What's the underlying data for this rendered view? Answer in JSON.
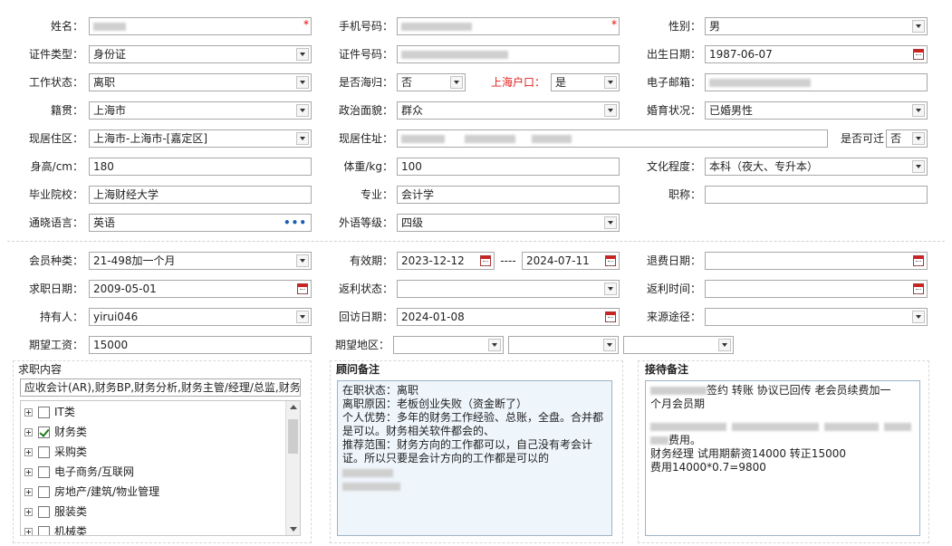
{
  "labels": {
    "name": "姓名：",
    "phone": "手机号码：",
    "gender": "性别：",
    "id_type": "证件类型：",
    "id_no": "证件号码：",
    "birth": "出生日期：",
    "work_status": "工作状态：",
    "returnee": "是否海归：",
    "sh_hukou": "上海户口：",
    "email": "电子邮箱：",
    "native": "籍贯：",
    "political": "政治面貌：",
    "marital": "婚育状况：",
    "residence_area": "现居住区：",
    "address": "现居住址：",
    "relocate": "是否可迁",
    "height": "身高/cm：",
    "weight": "体重/kg：",
    "education": "文化程度：",
    "school": "毕业院校：",
    "major": "专业：",
    "title": "职称：",
    "language": "通晓语言：",
    "lang_level": "外语等级：",
    "member_type": "会员种类：",
    "validity": "有效期：",
    "refund_date": "退费日期：",
    "job_date": "求职日期：",
    "rebate_status": "返利状态：",
    "rebate_time": "返利时间：",
    "holder": "持有人：",
    "visit_date": "回访日期：",
    "source": "来源途径：",
    "salary": "期望工资：",
    "region": "期望地区：",
    "range_sep": "----"
  },
  "values": {
    "gender": "男",
    "id_type": "身份证",
    "birth": "1987-06-07",
    "work_status": "离职",
    "returnee": "否",
    "sh_hukou": "是",
    "native": "上海市",
    "political": "群众",
    "marital": "已婚男性",
    "residence_area": "上海市-上海市-[嘉定区]",
    "relocate": "否",
    "height": "180",
    "weight": "100",
    "education": "本科（夜大、专升本）",
    "school": "上海财经大学",
    "major": "会计学",
    "title": "",
    "language": "英语",
    "lang_level": "四级",
    "member_type": "21-498加一个月",
    "validity_start": "2023-12-12",
    "validity_end": "2024-07-11",
    "refund_date": "",
    "job_date": "2009-05-01",
    "rebate_status": "",
    "rebate_time": "",
    "holder": "yirui046",
    "visit_date": "2024-01-08",
    "source": "",
    "salary": "15000",
    "region_1": "",
    "region_2": "",
    "region_3": ""
  },
  "required_mark": "*",
  "lang_more": "•••",
  "job_content": {
    "title": "求职内容",
    "summary": "应收会计(AR),财务BP,财务分析,财务主管/经理/总监,财务",
    "items": [
      {
        "label": "IT类",
        "checked": false
      },
      {
        "label": "财务类",
        "checked": true
      },
      {
        "label": "采购类",
        "checked": false
      },
      {
        "label": "电子商务/互联网",
        "checked": false
      },
      {
        "label": "房地产/建筑/物业管理",
        "checked": false
      },
      {
        "label": "服装类",
        "checked": false
      },
      {
        "label": "机械类",
        "checked": false
      }
    ]
  },
  "advisor_notes": {
    "title": "顾问备注",
    "lines": [
      "在职状态：离职",
      "离职原因：老板创业失败（资金断了）",
      "个人优势：多年的财务工作经验、总账，全盘。合并都",
      "是可以。财务相关软件都会的、",
      "推荐范围：财务方向的工作都可以，自己没有考会计",
      "证。所以只要是会计方向的工作都是可以的"
    ]
  },
  "reception_notes": {
    "title": "接待备注",
    "line1_tail": "签约    转账   协议已回传 老会员续费加一",
    "line2": "个月会员期",
    "line4_tail": "费用。",
    "line5": "财务经理 试用期薪资14000 转正15000",
    "line6": "费用14000*0.7=9800"
  }
}
